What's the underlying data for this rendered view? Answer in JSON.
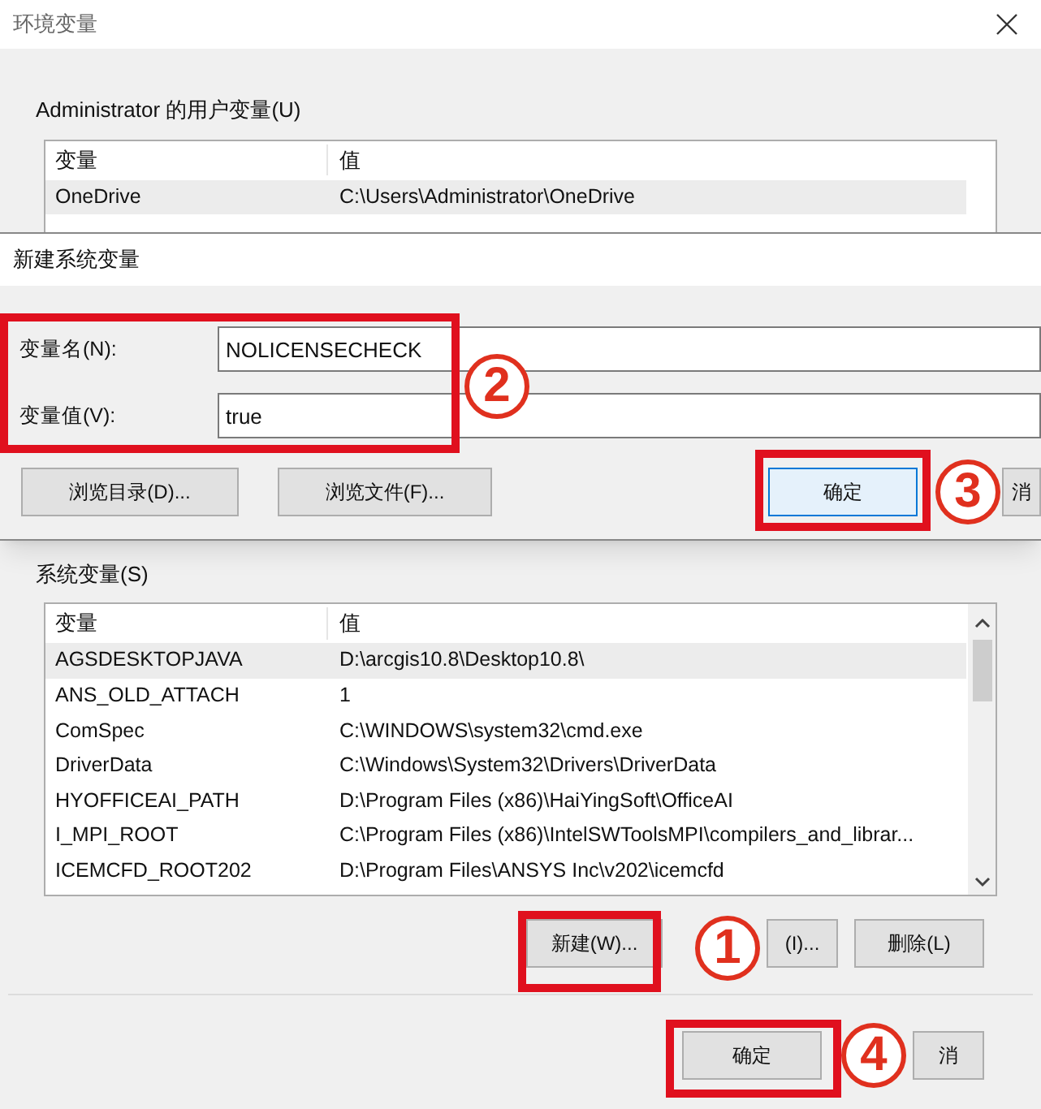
{
  "window": {
    "title": "环境变量"
  },
  "user_vars": {
    "label": "Administrator 的用户变量(U)",
    "columns": [
      "变量",
      "值"
    ],
    "rows": [
      {
        "name": "OneDrive",
        "value": "C:\\Users\\Administrator\\OneDrive",
        "selected": true
      }
    ]
  },
  "system_vars": {
    "label": "系统变量(S)",
    "columns": [
      "变量",
      "值"
    ],
    "rows": [
      {
        "name": "AGSDESKTOPJAVA",
        "value": "D:\\arcgis10.8\\Desktop10.8\\",
        "selected": true
      },
      {
        "name": "ANS_OLD_ATTACH",
        "value": "1",
        "selected": false
      },
      {
        "name": "ComSpec",
        "value": "C:\\WINDOWS\\system32\\cmd.exe",
        "selected": false
      },
      {
        "name": "DriverData",
        "value": "C:\\Windows\\System32\\Drivers\\DriverData",
        "selected": false
      },
      {
        "name": "HYOFFICEAI_PATH",
        "value": "D:\\Program Files (x86)\\HaiYingSoft\\OfficeAI",
        "selected": false
      },
      {
        "name": "I_MPI_ROOT",
        "value": "C:\\Program Files (x86)\\IntelSWToolsMPI\\compilers_and_librar...",
        "selected": false
      },
      {
        "name": "ICEMCFD_ROOT202",
        "value": "D:\\Program Files\\ANSYS Inc\\v202\\icemcfd",
        "selected": false
      }
    ],
    "buttons": [
      "新建(W)...",
      "(I)...",
      "删除(L)"
    ]
  },
  "buttons": [
    "确定",
    "消"
  ],
  "dialog": {
    "title": "新建系统变量",
    "fields": [
      {
        "label": "变量名(N):",
        "value": "NOLICENSECHECK"
      },
      {
        "label": "变量值(V):",
        "value": "true"
      }
    ],
    "browse_buttons": [
      "浏览目录(D)...",
      "浏览文件(F)..."
    ],
    "ok": "确定",
    "cancel": "消"
  },
  "annotations": [
    "1",
    "2",
    "3",
    "4"
  ]
}
